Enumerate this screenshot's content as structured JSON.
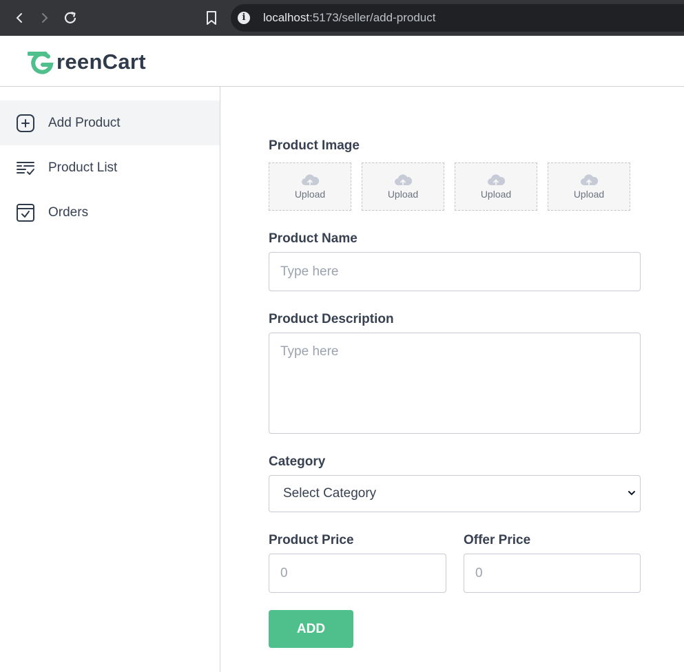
{
  "browser": {
    "url_host": "localhost",
    "url_path": ":5173/seller/add-product",
    "info_icon_glyph": "i"
  },
  "app": {
    "logo_text": "reenCart",
    "logo_initial": "G",
    "brand_color": "#4fbf8b"
  },
  "sidebar": {
    "items": [
      {
        "label": "Add Product",
        "icon": "add-square-icon",
        "active": true
      },
      {
        "label": "Product List",
        "icon": "list-check-icon",
        "active": false
      },
      {
        "label": "Orders",
        "icon": "calendar-check-icon",
        "active": false
      }
    ]
  },
  "form": {
    "image_label": "Product Image",
    "upload_label": "Upload",
    "name_label": "Product Name",
    "name_placeholder": "Type here",
    "description_label": "Product Description",
    "description_placeholder": "Type here",
    "category_label": "Category",
    "category_value": "Select Category",
    "price_label": "Product Price",
    "price_placeholder": "0",
    "offer_label": "Offer Price",
    "offer_placeholder": "0",
    "submit_label": "ADD"
  }
}
